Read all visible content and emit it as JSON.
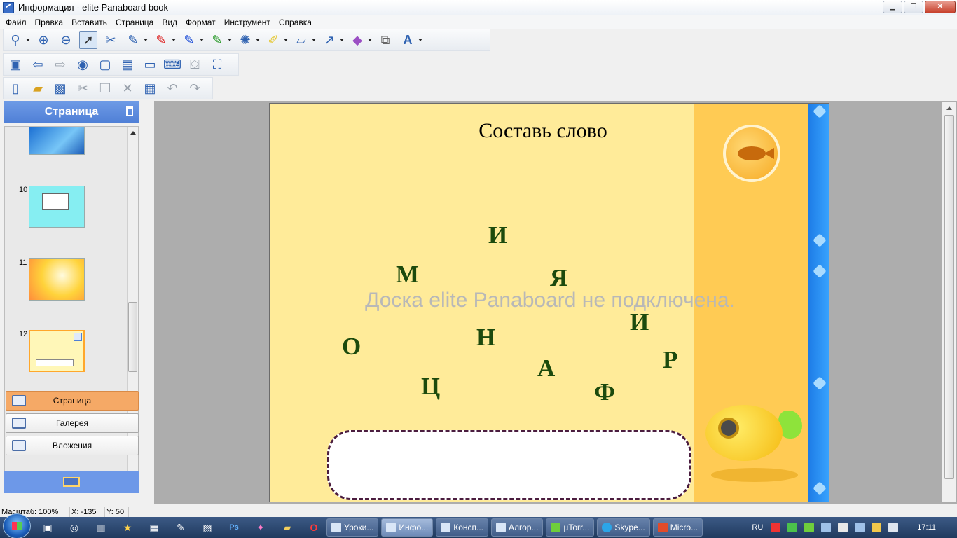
{
  "window": {
    "title": "Информация - elite Panaboard book",
    "minimize": "▁",
    "restore": "❐",
    "close": "✕"
  },
  "menu": [
    "Файл",
    "Правка",
    "Вставить",
    "Страница",
    "Вид",
    "Формат",
    "Инструмент",
    "Справка"
  ],
  "toolbar1_icons": [
    "zoom-icon",
    "zoom-in-icon",
    "zoom-out-icon",
    "select-arrow-icon",
    "lasso-icon",
    "pen-icon",
    "red-pen-icon",
    "blue-pen-icon",
    "green-pen-icon",
    "brush-icon",
    "highlighter-icon",
    "eraser-icon",
    "line-icon",
    "shape-icon",
    "layer-icon",
    "text-icon"
  ],
  "toolbar2_icons": [
    "new-page-icon",
    "prev-page-icon",
    "next-page-icon",
    "camera-icon",
    "capture-area-icon",
    "capture-window-icon",
    "capture-screen-icon",
    "keyboard-icon",
    "projector-icon",
    "fullscreen-icon"
  ],
  "toolbar3_icons": [
    "new-file-icon",
    "open-icon",
    "save-icon",
    "cut-icon",
    "copy-icon",
    "delete-icon",
    "paste-icon",
    "undo-icon",
    "redo-icon"
  ],
  "panel": {
    "header": "Страница",
    "thumbnails": [
      {
        "number": ""
      },
      {
        "number": "10"
      },
      {
        "number": "11"
      },
      {
        "number": "12"
      }
    ],
    "nav": {
      "page": "Страница",
      "gallery": "Галерея",
      "attachments": "Вложения"
    }
  },
  "slide": {
    "title": "Составь слово",
    "letters": [
      "И",
      "М",
      "Я",
      "И",
      "О",
      "Н",
      "Р",
      "А",
      "Ц",
      "Ф"
    ],
    "watermark": "Доска elite Panaboard не подключена."
  },
  "status": {
    "zoom": "Масштаб: 100%",
    "x": "X: -135",
    "y": "Y: 50"
  },
  "taskbar": {
    "tasks": [
      "Уроки...",
      "Инфо...",
      "Консп...",
      "Алгор...",
      "µTorr...",
      "Skype...",
      "Micro..."
    ],
    "lang": "RU",
    "clock": "17:11"
  }
}
